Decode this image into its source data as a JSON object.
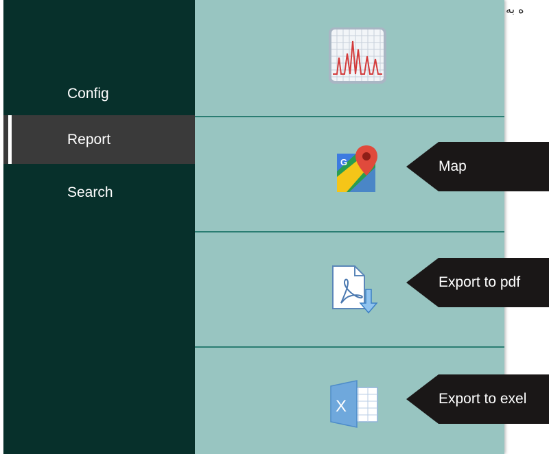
{
  "sidebar": {
    "items": [
      {
        "label": "Config",
        "active": false
      },
      {
        "label": "Report",
        "active": true
      },
      {
        "label": "Search",
        "active": false
      }
    ]
  },
  "panel": {
    "tiles": [
      {
        "icon": "line-chart-icon"
      },
      {
        "icon": "google-maps-icon",
        "callout": "Map"
      },
      {
        "icon": "pdf-export-icon",
        "callout": "Export to pdf"
      },
      {
        "icon": "excel-export-icon",
        "callout": "Export to exel"
      }
    ]
  },
  "corner_text": "ه به",
  "colors": {
    "sidebar_bg": "#07302b",
    "active_item_bg": "#3a3a3a",
    "panel_bg": "#98c5c1",
    "divider": "#2a7d72",
    "callout_bg": "#1a1717"
  }
}
